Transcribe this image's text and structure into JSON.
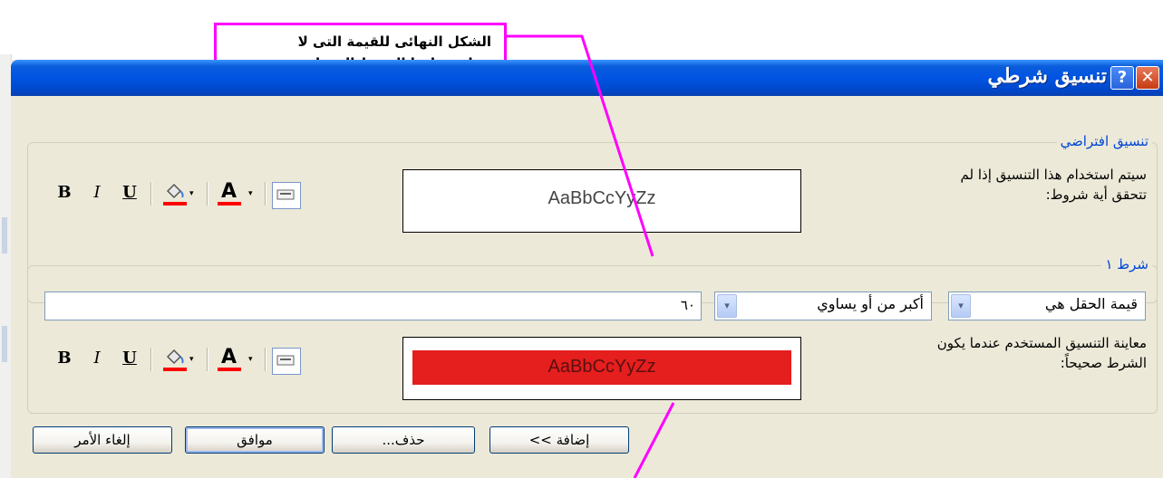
{
  "callout": {
    "line1": "الشكل النهائى للقيمة التى لا",
    "line2": "تنطبق عليها الشرط المختار"
  },
  "window": {
    "title": "تنسيق شرطي",
    "help_symbol": "?",
    "close_symbol": "✕"
  },
  "default_format": {
    "legend": "تنسيق افتراضي",
    "description_line1": "سيتم استخدام هذا التنسيق إذا لم",
    "description_line2": "تتحقق أية شروط:",
    "preview_text": "AaBbCcYyZz"
  },
  "condition1": {
    "legend": "شرط ١",
    "field_combo": "قيمة الحقل هي",
    "operator_combo": "أكبر من أو يساوي",
    "value_input": "٦٠",
    "description_line1": "معاينة التنسيق المستخدم عندما يكون",
    "description_line2": "الشرط صحيحاً:",
    "preview_text": "AaBbCcYyZz",
    "preview_bg": "#e51e1e"
  },
  "toolbar": {
    "bold": "B",
    "italic": "I",
    "underline": "U",
    "dropdown_arrow": "▾",
    "font_color_letter": "A",
    "fill_icon": "paint-bucket-icon",
    "enable_icon": "enable-format-icon",
    "accent": "#ff0000"
  },
  "buttons": {
    "add": "إضافة >>",
    "delete": "حذف...",
    "ok": "موافق",
    "cancel": "إلغاء الأمر"
  },
  "colors": {
    "callout_border": "#ff00ff",
    "title_bar": "#0054e3",
    "dialog_bg": "#ece9d8"
  }
}
